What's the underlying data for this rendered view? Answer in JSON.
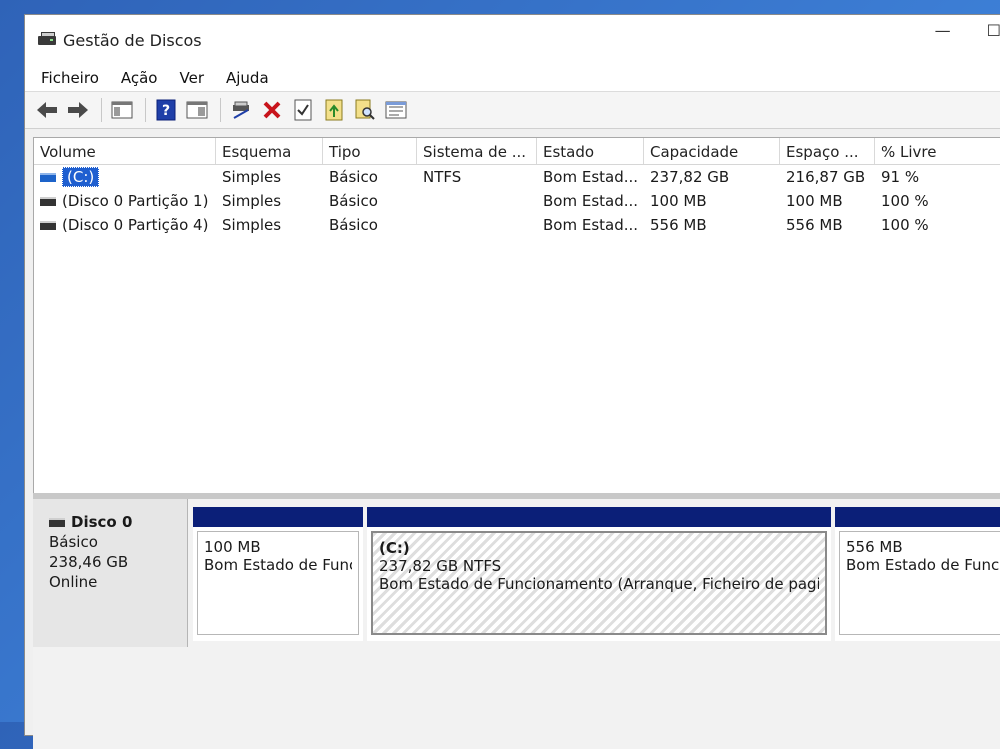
{
  "window": {
    "title": "Gestão de Discos",
    "minimize": "—",
    "maximize": "☐"
  },
  "menu": [
    "Ficheiro",
    "Ação",
    "Ver",
    "Ajuda"
  ],
  "toolbar": {
    "icons": [
      "back-arrow-icon",
      "forward-arrow-icon",
      "show-hide-console-tree-icon",
      "help-icon",
      "properties-icon",
      "connect-disk-icon",
      "delete-icon",
      "check-icon",
      "export-list-icon",
      "find-icon",
      "properties-list-icon"
    ]
  },
  "columns": [
    "Volume",
    "Esquema",
    "Tipo",
    "Sistema de ...",
    "Estado",
    "Capacidade",
    "Espaço ...",
    "% Livre"
  ],
  "volumes": [
    {
      "volume": "(C:)",
      "esquema": "Simples",
      "tipo": "Básico",
      "sistema": "NTFS",
      "estado": "Bom Estad...",
      "capacidade": "237,82 GB",
      "espaco": "216,87 GB",
      "livre": "91 %"
    },
    {
      "volume": "(Disco 0 Partição 1)",
      "esquema": "Simples",
      "tipo": "Básico",
      "sistema": "",
      "estado": "Bom Estad...",
      "capacidade": "100 MB",
      "espaco": "100 MB",
      "livre": "100 %"
    },
    {
      "volume": "(Disco 0 Partição 4)",
      "esquema": "Simples",
      "tipo": "Básico",
      "sistema": "",
      "estado": "Bom Estad...",
      "capacidade": "556 MB",
      "espaco": "556 MB",
      "livre": "100 %"
    }
  ],
  "disk": {
    "name": "Disco 0",
    "type": "Básico",
    "size": "238,46 GB",
    "status": "Online",
    "partitions": [
      {
        "label": "",
        "size": "100 MB",
        "status": "Bom Estado de Func"
      },
      {
        "label": "(C:)",
        "size": "237,82 GB NTFS",
        "status": "Bom Estado de Funcionamento (Arranque, Ficheiro de pagin"
      },
      {
        "label": "",
        "size": "556 MB",
        "status": "Bom Estado de Func"
      }
    ]
  },
  "colors": {
    "partition_bar": "#0b1f78",
    "selection": "#1f5fd0"
  }
}
